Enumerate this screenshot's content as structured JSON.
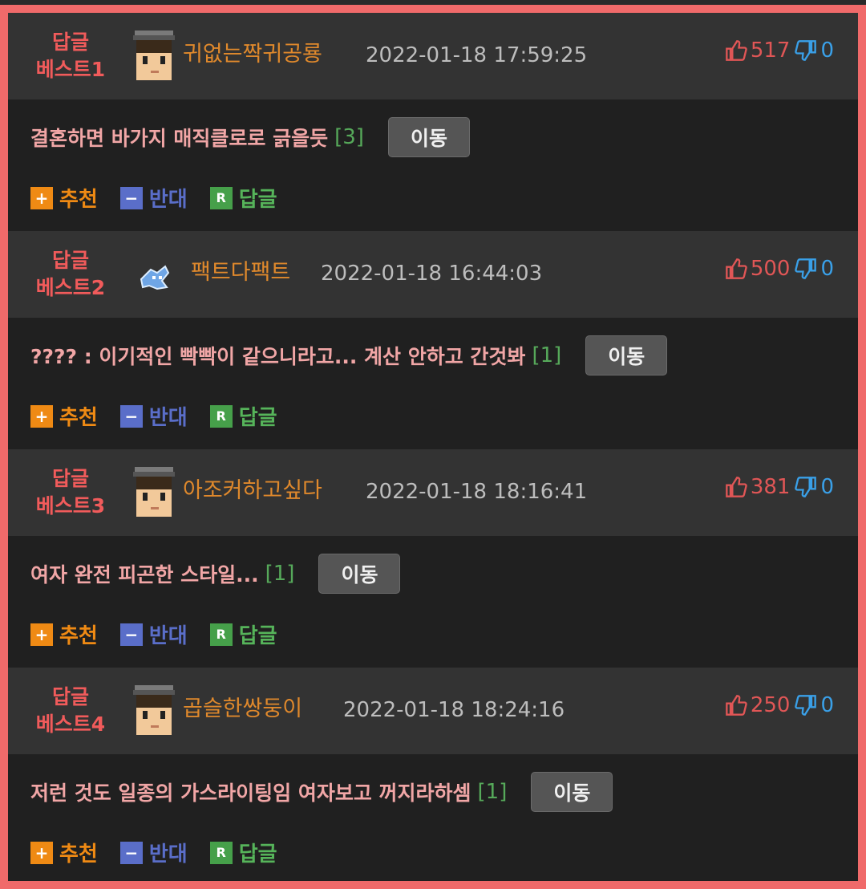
{
  "posts": [
    {
      "rank_line1": "답글",
      "rank_line2": "베스트1",
      "nickname": "귀없는짝귀공룡",
      "datetime": "2022-01-18 17:59:25",
      "up": "517",
      "down": "0",
      "title": "결혼하면 바가지 매직클로로 긁을듯",
      "comment_count": "[3]",
      "move_label": "이동",
      "avatar": "pixel-face-avatar"
    },
    {
      "rank_line1": "답글",
      "rank_line2": "베스트2",
      "nickname": "팩트다팩트",
      "datetime": "2022-01-18 16:44:03",
      "up": "500",
      "down": "0",
      "title": "???? : 이기적인 빡빡이 같으니라고... 계산 안하고 간것봐",
      "comment_count": "[1]",
      "move_label": "이동",
      "avatar": "pixel-creature-avatar"
    },
    {
      "rank_line1": "답글",
      "rank_line2": "베스트3",
      "nickname": "아조커하고싶다",
      "datetime": "2022-01-18 18:16:41",
      "up": "381",
      "down": "0",
      "title": "여자 완전 피곤한 스타일...",
      "comment_count": "[1]",
      "move_label": "이동",
      "avatar": "pixel-face-avatar"
    },
    {
      "rank_line1": "답글",
      "rank_line2": "베스트4",
      "nickname": "곱슬한쌍둥이",
      "datetime": "2022-01-18 18:24:16",
      "up": "250",
      "down": "0",
      "title": "저런 것도 일종의 가스라이팅임 여자보고 꺼지라하셈",
      "comment_count": "[1]",
      "move_label": "이동",
      "avatar": "pixel-face-avatar"
    }
  ],
  "actions": {
    "recommend_icon": "+",
    "recommend_label": "추천",
    "oppose_icon": "−",
    "oppose_label": "반대",
    "reply_icon": "R",
    "reply_label": "답글"
  },
  "colors": {
    "border": "#f06a6a",
    "rank": "#f15b5b",
    "nickname": "#e0892c",
    "title": "#f1a6a6",
    "comment_count": "#56a95a",
    "up": "#e05656",
    "down": "#3aa0e8"
  }
}
